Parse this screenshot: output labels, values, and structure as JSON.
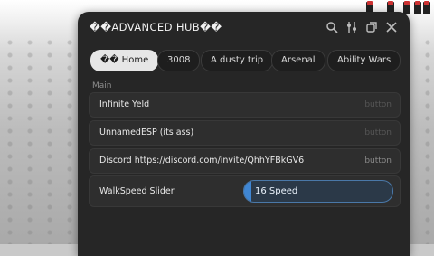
{
  "window": {
    "title": "��ADVANCED HUB��"
  },
  "tabs": [
    {
      "label": "�� Home",
      "active": true
    },
    {
      "label": "3008",
      "active": false
    },
    {
      "label": "A dusty trip",
      "active": false
    },
    {
      "label": "Arsenal",
      "active": false
    },
    {
      "label": "Ability Wars",
      "active": false
    }
  ],
  "main": {
    "section_label": "Main",
    "rows": [
      {
        "label": "Infinite Yeld",
        "hint": "button"
      },
      {
        "label": "UnnamedESP (its ass)",
        "hint": "button"
      },
      {
        "label": "Discord https://discord.com/invite/QhhYFBkGV6",
        "hint": "button"
      }
    ],
    "slider": {
      "label": "WalkSpeed Slider",
      "value_text": "16 Speed",
      "fill_fraction": 0.05
    }
  },
  "icons": [
    "search-icon",
    "settings-icon",
    "minimize-icon",
    "close-icon"
  ],
  "colors": {
    "window_bg": "#262626",
    "accent": "#3f86d3",
    "active_tab_bg": "#e6e6e6"
  }
}
